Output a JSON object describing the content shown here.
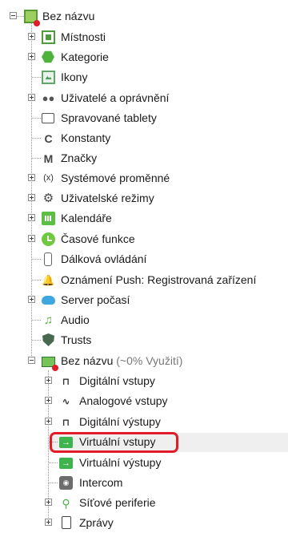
{
  "tree": {
    "root": {
      "label": "Bez názvu",
      "icon": "project-icon"
    },
    "items": [
      {
        "label": "Místnosti",
        "icon": "room-icon"
      },
      {
        "label": "Kategorie",
        "icon": "category-hexagon-icon"
      },
      {
        "label": "Ikony",
        "icon": "image-icon"
      },
      {
        "label": "Uživatelé a oprávnění",
        "icon": "users-icon"
      },
      {
        "label": "Spravované tablety",
        "icon": "tablet-icon"
      },
      {
        "label": "Konstanty",
        "icon": "constant-c-icon"
      },
      {
        "label": "Značky",
        "icon": "marker-m-icon"
      },
      {
        "label": "Systémové proměnné",
        "icon": "variable-x-icon"
      },
      {
        "label": "Uživatelské režimy",
        "icon": "gear-icon"
      },
      {
        "label": "Kalendáře",
        "icon": "calendar-icon"
      },
      {
        "label": "Časové funkce",
        "icon": "clock-icon"
      },
      {
        "label": "Dálková ovládání",
        "icon": "remote-control-icon"
      },
      {
        "label": "Oznámení Push: Registrovaná zařízení",
        "icon": "bell-icon"
      },
      {
        "label": "Server počasí",
        "icon": "weather-cloud-icon"
      },
      {
        "label": "Audio",
        "icon": "music-note-icon"
      },
      {
        "label": "Trusts",
        "icon": "shield-icon"
      }
    ],
    "device": {
      "label": "Bez názvu",
      "status": "(~0% Využití)",
      "icon": "miniserver-icon"
    },
    "children": [
      {
        "label": "Digitální vstupy",
        "icon": "digital-input-icon"
      },
      {
        "label": "Analogové vstupy",
        "icon": "analog-wave-icon"
      },
      {
        "label": "Digitální výstupy",
        "icon": "digital-output-icon"
      },
      {
        "label": "Virtuální vstupy",
        "icon": "virtual-input-icon"
      },
      {
        "label": "Virtuální výstupy",
        "icon": "virtual-output-icon"
      },
      {
        "label": "Intercom",
        "icon": "intercom-camera-icon"
      },
      {
        "label": "Síťové periferie",
        "icon": "network-icon"
      },
      {
        "label": "Zprávy",
        "icon": "document-icon"
      }
    ]
  },
  "colors": {
    "highlight": "#e11b2a",
    "selection": "#efefef",
    "green": "#4db33d"
  }
}
